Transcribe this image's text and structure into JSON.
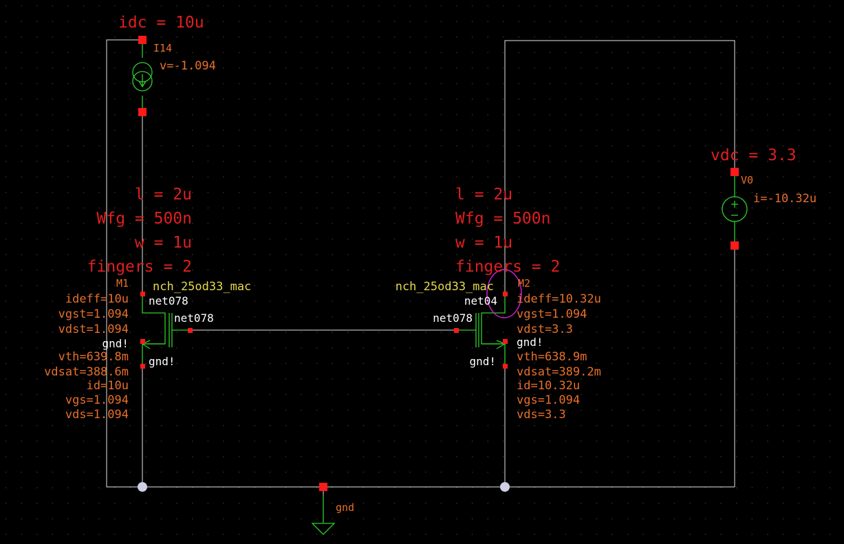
{
  "schematic": {
    "colors": {
      "background": "#000000",
      "grid_dot": "#4a4a4a",
      "wire": "#e6e6e6",
      "device": "#2ed12e",
      "pin": "#ff1a1a",
      "param_text": "#e01f1f",
      "op_text": "#e8702a",
      "net_text": "#ffffff",
      "model_text": "#e6d84a",
      "selection": "#d11fd1"
    },
    "i14": {
      "param": "idc = 10u",
      "name": "I14",
      "op": "v=-1.094"
    },
    "v0": {
      "param": "vdc = 3.3",
      "name": "V0",
      "op": "i=-10.32u"
    },
    "m1": {
      "params": [
        "l = 2u",
        "Wfg = 500n",
        "w = 1u",
        "fingers = 2"
      ],
      "name": "M1",
      "model": "nch_25od33_mac",
      "op_left": [
        "ideff=10u",
        "vgst=1.094",
        "vdst=1.094"
      ],
      "op_left_lower": [
        "vth=639.8m",
        "vdsat=388.6m",
        "id=10u",
        "vgs=1.094",
        "vds=1.094"
      ],
      "net_drain": "net078",
      "net_gate": "net078",
      "gnd_a": "gnd!",
      "gnd_b": "gnd!"
    },
    "m2": {
      "params": [
        "l = 2u",
        "Wfg = 500n",
        "w = 1u",
        "fingers = 2"
      ],
      "name": "M2",
      "model": "nch_25od33_mac",
      "op_right": [
        "ideff=10.32u",
        "vgst=1.094",
        "vdst=3.3"
      ],
      "op_right_lower": [
        "vth=638.9m",
        "vdsat=389.2m",
        "id=10.32u",
        "vgs=1.094",
        "vds=3.3"
      ],
      "net_drain": "net04",
      "net_gate": "net078",
      "gnd_a": "gnd!",
      "gnd_b": "gnd!"
    },
    "ground": {
      "label": "gnd"
    },
    "icons": {
      "current_source": "current-source-icon",
      "voltage_source": "voltage-source-icon",
      "nmos": "nmos-transistor-icon",
      "ground": "ground-icon"
    }
  }
}
